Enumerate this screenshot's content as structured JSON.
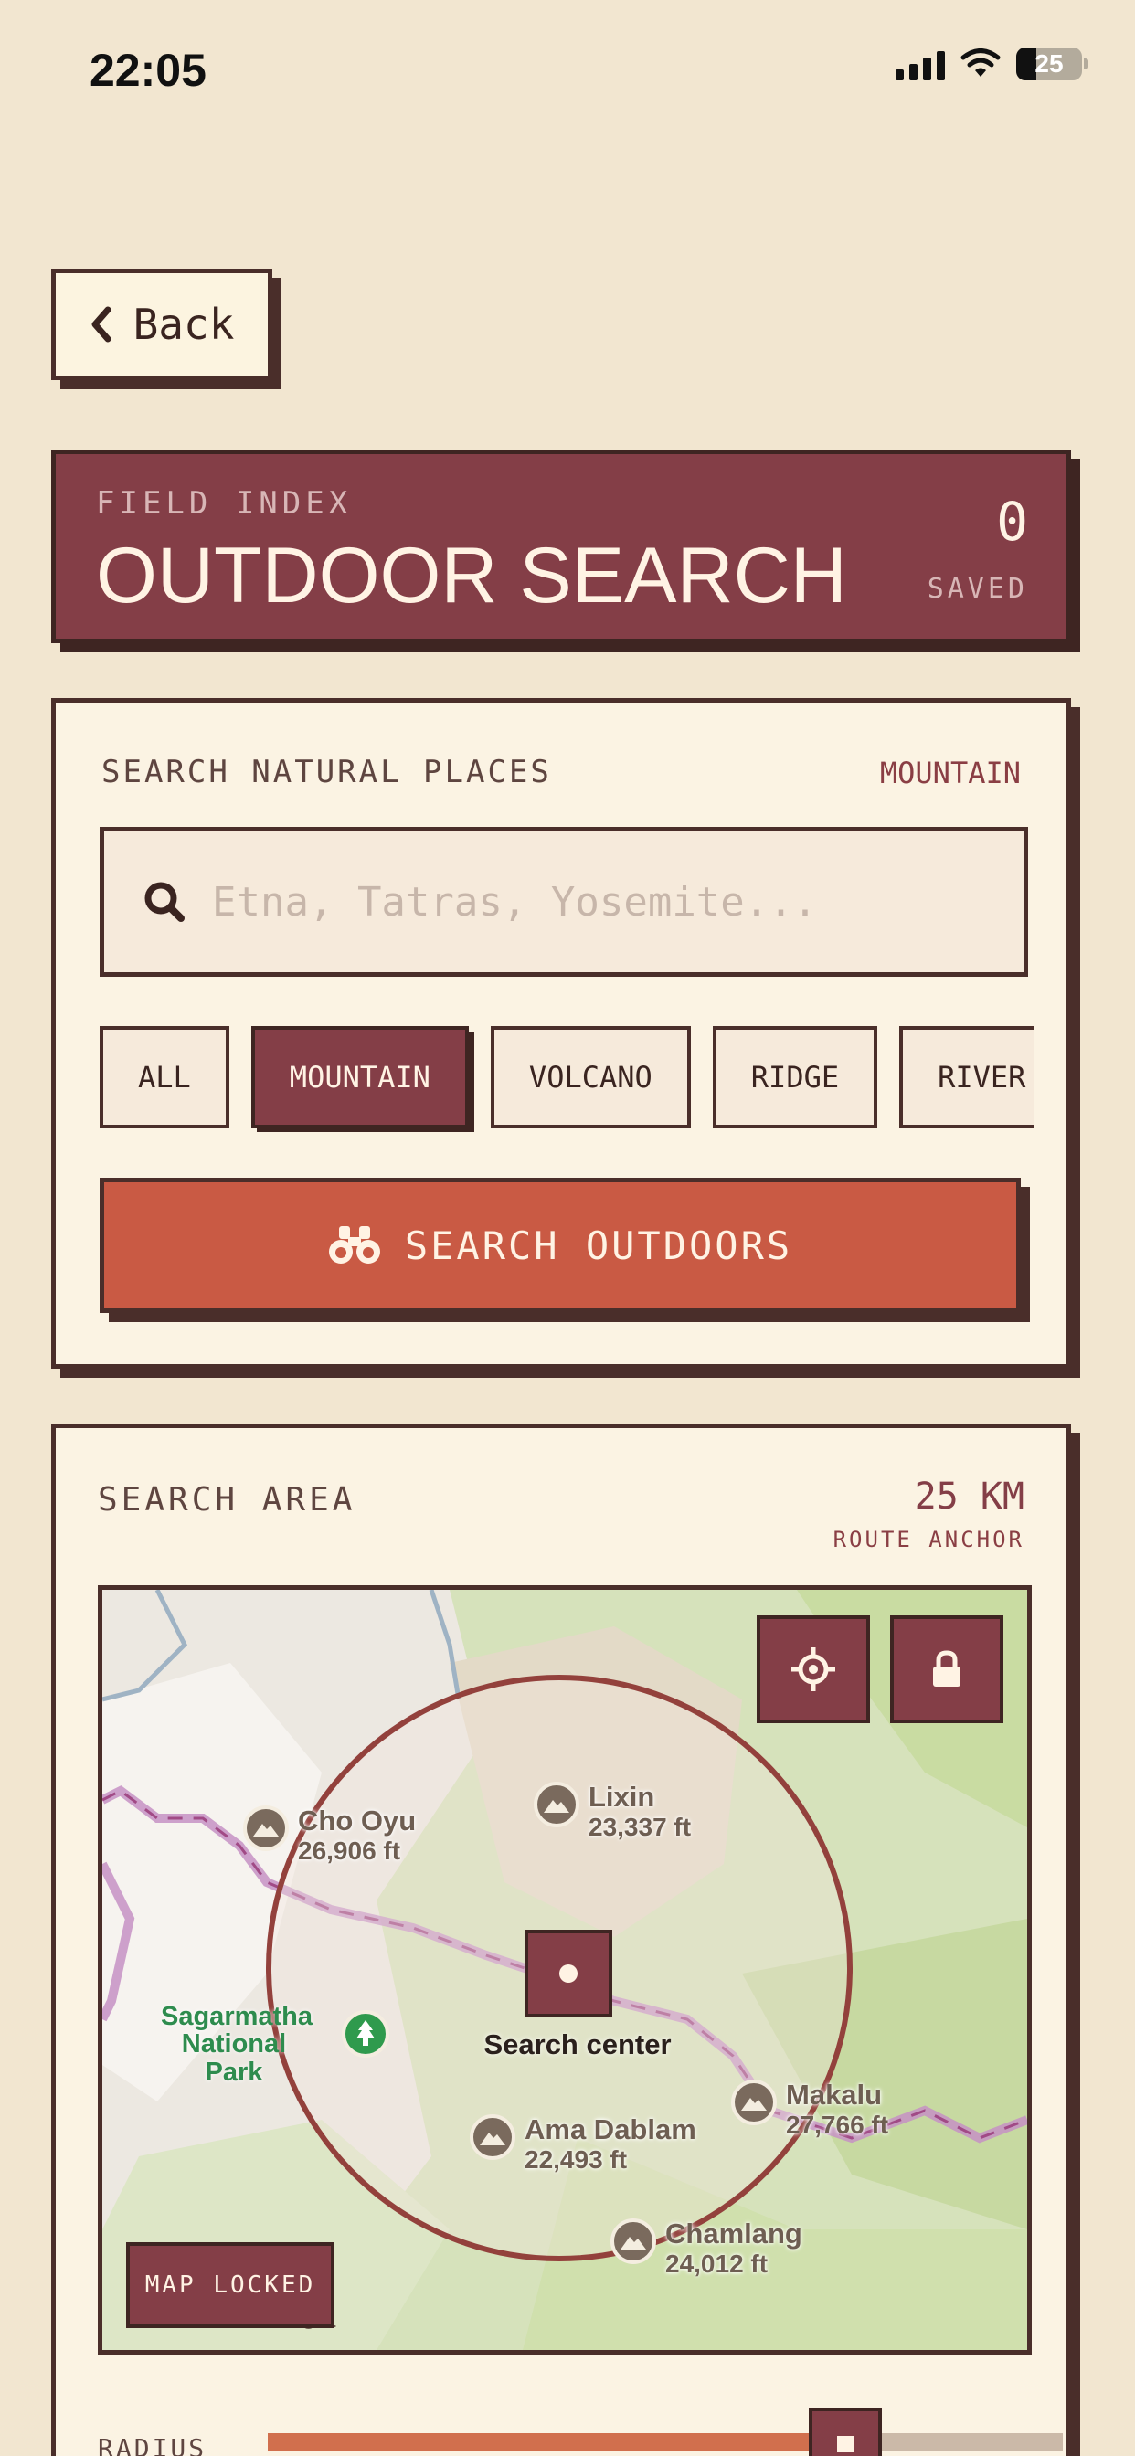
{
  "status_bar": {
    "time": "22:05",
    "battery": "25"
  },
  "nav": {
    "back_label": "Back"
  },
  "header": {
    "eyebrow": "FIELD INDEX",
    "title": "OUTDOOR SEARCH",
    "saved_count": "0",
    "saved_label": "SAVED"
  },
  "search": {
    "label": "SEARCH NATURAL PLACES",
    "active_category": "MOUNTAIN",
    "placeholder": "Etna, Tatras, Yosemite...",
    "chips": [
      {
        "label": "ALL",
        "active": false
      },
      {
        "label": "MOUNTAIN",
        "active": true
      },
      {
        "label": "VOLCANO",
        "active": false
      },
      {
        "label": "RIDGE",
        "active": false
      },
      {
        "label": "RIVER",
        "active": false
      }
    ],
    "button_label": "SEARCH OUTDOORS"
  },
  "area": {
    "label": "SEARCH AREA",
    "radius_value": "25 KM",
    "sub_label": "ROUTE ANCHOR",
    "map": {
      "peaks": [
        {
          "name": "Cho Oyu",
          "elevation": "26,906 ft"
        },
        {
          "name": "Lixin",
          "elevation": "23,337 ft"
        },
        {
          "name": "Makalu",
          "elevation": "27,766 ft"
        },
        {
          "name": "Ama Dablam",
          "elevation": "22,493 ft"
        },
        {
          "name": "Chamlang",
          "elevation": "24,012 ft"
        }
      ],
      "park_name": "Sagarmatha National Park",
      "center_label": "Search center",
      "legal_text": "gal",
      "locked_label": "MAP LOCKED"
    },
    "radius_label": "RADIUS",
    "radius_fraction": 0.71
  },
  "colors": {
    "background": "#f2e6d0",
    "brand": "#843e47",
    "accent": "#c95a44",
    "ink": "#4a2e2a",
    "radius_fill": "#d16f4d"
  },
  "icons": [
    "chevron-left-icon",
    "search-icon",
    "binoculars-icon",
    "crosshair-icon",
    "lock-icon",
    "mountain-icon",
    "tree-icon"
  ]
}
